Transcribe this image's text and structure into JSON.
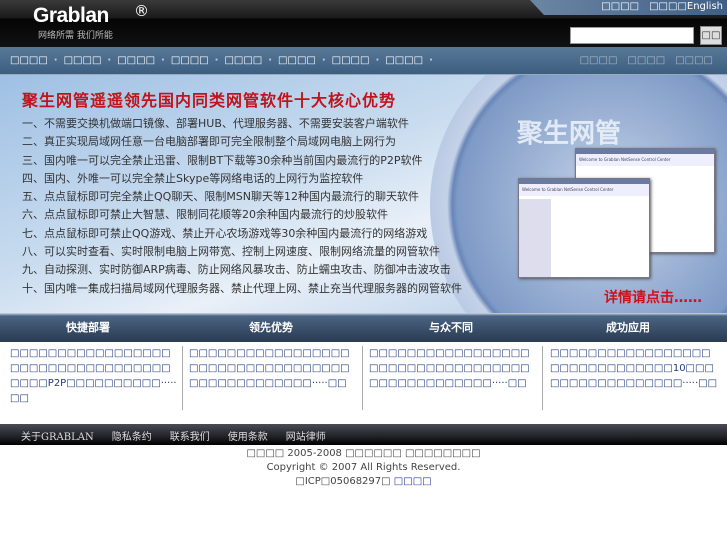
{
  "header": {
    "logo": "Grablan",
    "registered": "®",
    "tagline": "网络所需  我们所能",
    "top_links": [
      "□□□□",
      "□□□□English"
    ],
    "search_placeholder": "",
    "search_button": "□□"
  },
  "nav": {
    "items": [
      "□□□□",
      "□□□□",
      "□□□□",
      "□□□□",
      "□□□□",
      "□□□□",
      "□□□□",
      "□□□□"
    ],
    "right_items": [
      "□□□□",
      "□□□□",
      "□□□□"
    ]
  },
  "banner": {
    "title": "聚生网管遥遥领先国内同类网管软件十大核心优势",
    "lines": [
      "一、不需要交换机做端口镜像、部署HUB、代理服务器、不需要安装客户端软件",
      "二、真正实现局域网任意一台电脑部署即可完全限制整个局域网电脑上网行为",
      "三、国内唯一可以完全禁止迅雷、限制BT下载等30余种当前国内最流行的P2P软件",
      "四、国内、外唯一可以完全禁止Skype等网络电话的上网行为监控软件",
      "五、点点鼠标即可完全禁止QQ聊天、限制MSN聊天等12种国内最流行的聊天软件",
      "六、点点鼠标即可禁止大智慧、限制同花顺等20余种国内最流行的炒股软件",
      "七、点点鼠标即可禁止QQ游戏、禁止开心农场游戏等30余种国内最流行的网络游戏",
      "八、可以实时查看、实时限制电脑上网带宽、控制上网速度、限制网络流量的网管软件",
      "九、自动探测、实时防御ARP病毒、防止网络风暴攻击、防止蠕虫攻击、防御冲击波攻击",
      "十、国内唯一集成扫描局域网代理服务器、禁止代理上网、禁止充当代理服务器的网管软件"
    ],
    "product_logo": "聚生网管",
    "window_title": "Welcome to Grablan NetSense Control Center",
    "more": "详情请点击……"
  },
  "sections": [
    {
      "title": "快捷部署",
      "text": "□□□□□□□□□□□□□□□□□□□□□□□□□□□□□□□□□□□□□□P2P□□□□□□□□□□·····□□"
    },
    {
      "title": "领先优势",
      "text": "□□□□□□□□□□□□□□□□□□□□□□□□□□□□□□□□□□□□□□□□□□□□□□□·····□□"
    },
    {
      "title": "与众不同",
      "text": "□□□□□□□□□□□□□□□□□□□□□□□□□□□□□□□□□□□□□□□□□□□□□□□·····□□"
    },
    {
      "title": "成功应用",
      "text": "□□□□□□□□□□□□□□□□□□□□□□□□□□□□□□10□□□□□□□□□□□□□□□□□·····□□"
    }
  ],
  "footer": {
    "links": [
      "关于GRABLAN",
      "隐私条约",
      "联系我们",
      "使用条款",
      "网站律师"
    ],
    "line1": "□□□□ 2005-2008 □□□□□□ □□□□□□□□",
    "line2": "Copyright © 2007 All Rights Reserved.",
    "icp": "□ICP□05068297□",
    "icp_link": "□□□□"
  }
}
